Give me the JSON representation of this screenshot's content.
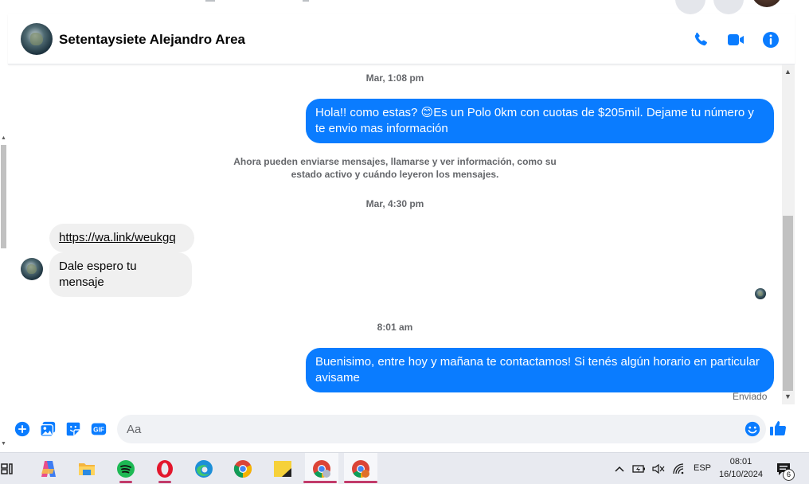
{
  "colors": {
    "messenger_blue": "#0a7cff",
    "bubble_gray": "#f0f0f0",
    "secondary_text": "#65676b"
  },
  "chat_header": {
    "contact_name": "Setentaysiete Alejandro Area",
    "icons": [
      "phone-icon",
      "video-camera-icon",
      "info-icon"
    ]
  },
  "messages": {
    "timestamp_1": "Mar, 1:08 pm",
    "outgoing_1": "Hola!! como estas? 😊Es un Polo 0km con cuotas de $205mil. Dejame tu número y te envio mas información",
    "system_note": "Ahora pueden enviarse mensajes, llamarse y ver información, como su estado activo y cuándo leyeron los mensajes.",
    "timestamp_2": "Mar, 4:30 pm",
    "incoming_link": "https://wa.link/weukgq",
    "incoming_2": "Dale espero tu mensaje",
    "timestamp_3": "8:01 am",
    "outgoing_2": "Buenisimo, entre hoy y mañana te contactamos! Si tenés algún horario en particular avisame",
    "sent_status": "Enviado"
  },
  "composer": {
    "placeholder": "Aa",
    "icons": [
      "plus-icon",
      "image-icon",
      "sticker-icon",
      "gif-icon",
      "emoji-icon",
      "thumbs-up-icon"
    ],
    "gif_label": "GIF"
  },
  "taskbar": {
    "apps": [
      "task-view-icon",
      "copilot-icon",
      "file-explorer-icon",
      "spotify-icon",
      "opera-icon",
      "edge-icon",
      "chrome-icon",
      "sticky-notes-icon",
      "chrome-profile-icon",
      "chrome-profile-2-icon"
    ],
    "language": "ESP",
    "time": "08:01",
    "date": "16/10/2024",
    "notification_count": "6"
  }
}
